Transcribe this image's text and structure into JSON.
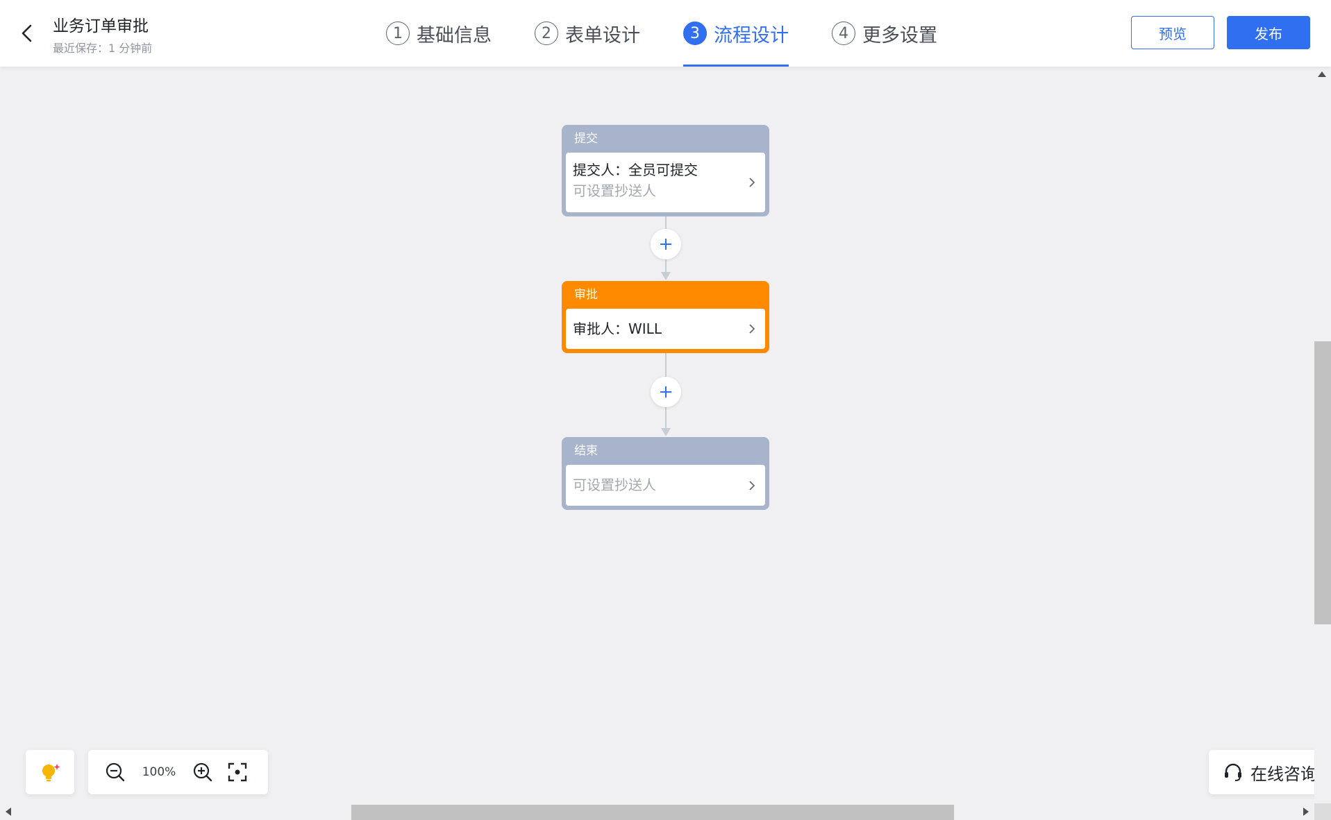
{
  "header": {
    "title": "业务订单审批",
    "last_saved": "最近保存：1 分钟前",
    "steps": [
      {
        "num": "1",
        "label": "基础信息"
      },
      {
        "num": "2",
        "label": "表单设计"
      },
      {
        "num": "3",
        "label": "流程设计",
        "active": true
      },
      {
        "num": "4",
        "label": "更多设置"
      }
    ],
    "preview_label": "预览",
    "publish_label": "发布"
  },
  "flow": {
    "nodes": [
      {
        "title": "提交",
        "line1": "提交人：全员可提交",
        "line2": "可设置抄送人",
        "color": "#a8b3cc"
      },
      {
        "title": "审批",
        "line1": "审批人：WILL",
        "color": "#ff8a00"
      },
      {
        "title": "结束",
        "line2": "可设置抄送人",
        "color": "#a8b3cc"
      }
    ]
  },
  "tools": {
    "zoom_level": "100%",
    "consult_label": "在线咨询"
  },
  "colors": {
    "accent": "#2f6ff0",
    "approval_node": "#ff8a00",
    "default_node": "#a8b3cc"
  }
}
